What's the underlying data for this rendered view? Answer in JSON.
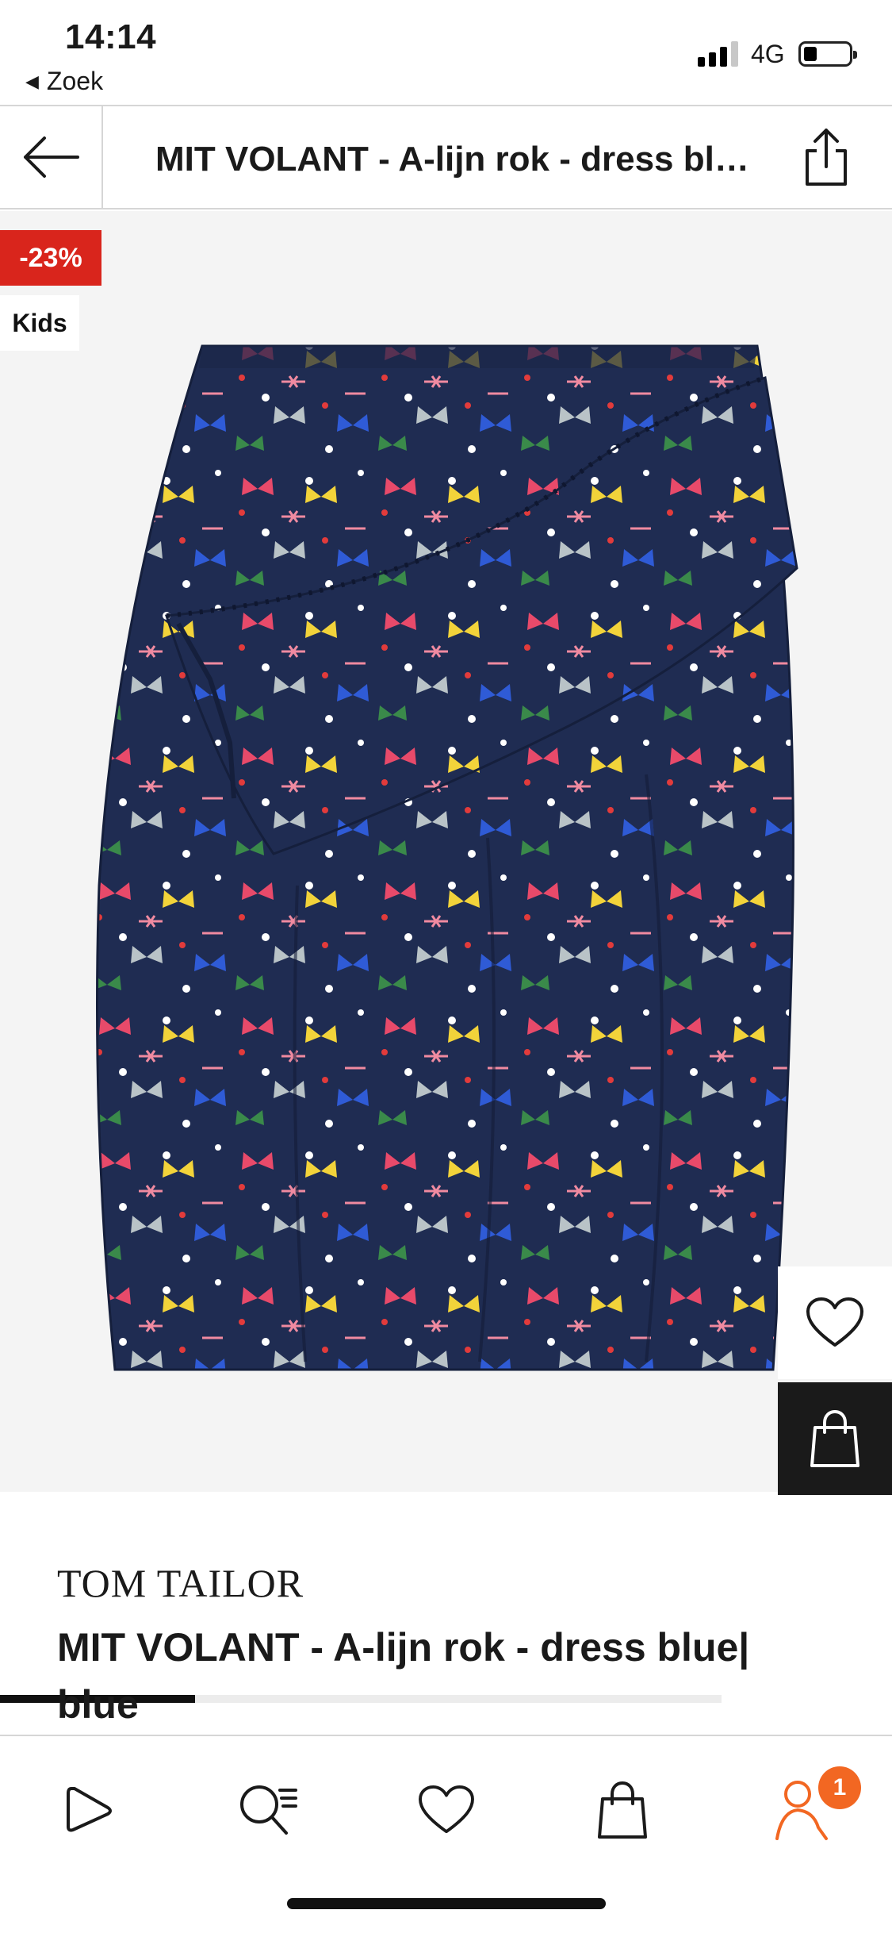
{
  "status_bar": {
    "time": "14:14",
    "back_app_label": "Zoek",
    "network": "4G",
    "signal_bars_active": 3,
    "signal_bars_total": 4
  },
  "header": {
    "title": "MIT VOLANT - A-lijn rok - dress blue| blue",
    "back_icon": "arrow-left-icon",
    "share_icon": "share-icon"
  },
  "gallery": {
    "discount_badge": "-23%",
    "category_badge": "Kids",
    "image_description_icon": "skirt-product-image",
    "image_progress": 0.27,
    "colors": {
      "discount": "#d9251c",
      "skirt_navy": "#1f2c52"
    }
  },
  "actions": {
    "wishlist_icon": "heart-icon",
    "bag_icon": "shopping-bag-icon"
  },
  "product": {
    "brand": "TOM TAILOR",
    "name": "MIT VOLANT - A-lijn rok - dress blue| blue"
  },
  "tabbar": {
    "items": [
      {
        "icon": "home-play-icon"
      },
      {
        "icon": "search-list-icon"
      },
      {
        "icon": "heart-icon"
      },
      {
        "icon": "shopping-bag-icon"
      },
      {
        "icon": "user-icon",
        "active": true
      }
    ],
    "account_badge": "1",
    "accent_color": "#f26722"
  }
}
